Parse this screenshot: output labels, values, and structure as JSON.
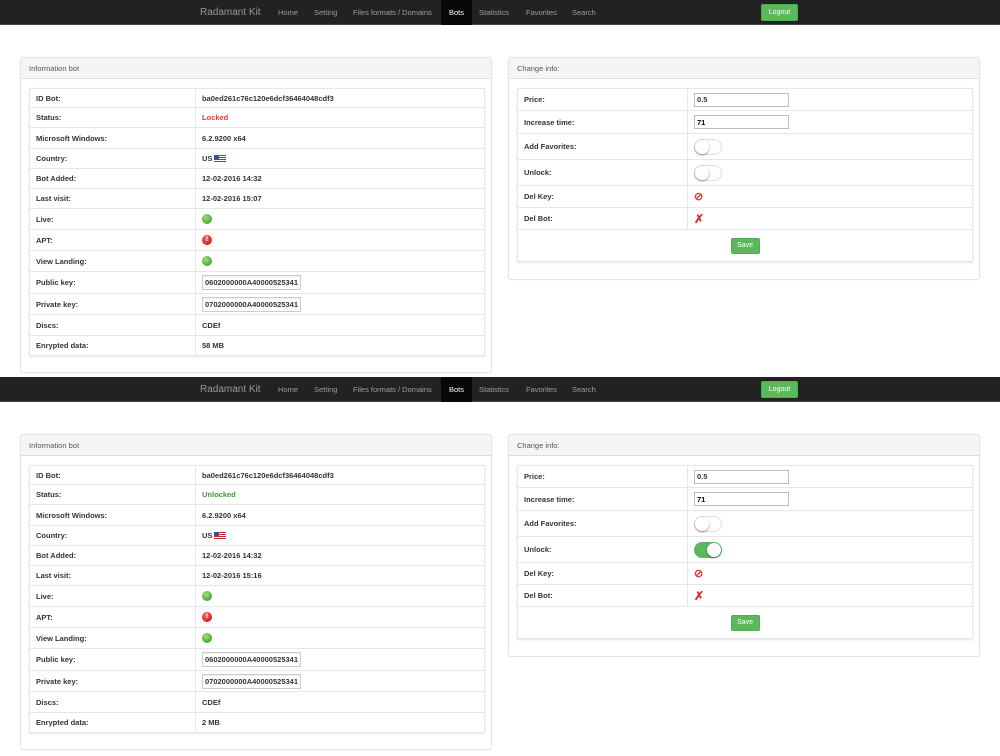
{
  "screens": [
    {
      "nav": {
        "brand": "Radamant Kit",
        "items": [
          "Home",
          "Setting",
          "Files formats / Domains",
          "Bots",
          "Statistics",
          "Favorites",
          "Search"
        ],
        "active": "Bots",
        "logout": "Logout"
      },
      "info": {
        "title": "Information bot",
        "rows": [
          {
            "label": "ID Bot:",
            "value": "ba0ed261c76c120e6dcf36464048cdf3"
          },
          {
            "label": "Status:",
            "value": "Locked",
            "type": "status-locked"
          },
          {
            "label": "Microsoft Windows:",
            "value": "6.2.9200 x64"
          },
          {
            "label": "Country:",
            "value": "US",
            "type": "flag"
          },
          {
            "label": "Bot Added:",
            "value": "12-02-2016 14:32"
          },
          {
            "label": "Last visit:",
            "value": "12-02-2016 15:07"
          },
          {
            "label": "Live:",
            "icon": "check-circle-icon",
            "type": "ok"
          },
          {
            "label": "APT:",
            "icon": "alert-circle-icon",
            "type": "err"
          },
          {
            "label": "View Landing:",
            "icon": "check-circle-icon",
            "type": "ok"
          },
          {
            "label": "Public key:",
            "value": "0602000000A40000525341",
            "type": "key"
          },
          {
            "label": "Private key:",
            "value": "0702000000A40000525341",
            "type": "key"
          },
          {
            "label": "Discs:",
            "value": "CDEf"
          },
          {
            "label": "Enrypted data:",
            "value": "58 MB"
          }
        ]
      },
      "change": {
        "title": "Change info:",
        "price_label": "Price:",
        "price": "0.5",
        "increase_label": "Increase time:",
        "increase": "71",
        "favorites_label": "Add Favorites:",
        "favorites_on": false,
        "unlock_label": "Unlock:",
        "unlock_on": false,
        "delkey_label": "Del Key:",
        "delbot_label": "Del Bot:",
        "save": "Save"
      }
    },
    {
      "nav": {
        "brand": "Radamant Kit",
        "items": [
          "Home",
          "Setting",
          "Files formats / Domains",
          "Bots",
          "Statistics",
          "Favorites",
          "Search"
        ],
        "active": "Bots",
        "logout": "Logout"
      },
      "info": {
        "title": "Information bot",
        "rows": [
          {
            "label": "ID Bot:",
            "value": "ba0ed261c76c120e6dcf36464048cdf3"
          },
          {
            "label": "Status:",
            "value": "Unlocked",
            "type": "status-unlocked"
          },
          {
            "label": "Microsoft Windows:",
            "value": "6.2.9200 x64"
          },
          {
            "label": "Country:",
            "value": "US",
            "type": "flag"
          },
          {
            "label": "Bot Added:",
            "value": "12-02-2016 14:32"
          },
          {
            "label": "Last visit:",
            "value": "12-02-2016 15:16"
          },
          {
            "label": "Live:",
            "icon": "check-circle-icon",
            "type": "ok"
          },
          {
            "label": "APT:",
            "icon": "alert-circle-icon",
            "type": "err"
          },
          {
            "label": "View Landing:",
            "icon": "check-circle-icon",
            "type": "ok"
          },
          {
            "label": "Public key:",
            "value": "0602000000A40000525341",
            "type": "key"
          },
          {
            "label": "Private key:",
            "value": "0702000000A40000525341",
            "type": "key"
          },
          {
            "label": "Discs:",
            "value": "CDEf"
          },
          {
            "label": "Enrypted data:",
            "value": "2 MB"
          }
        ]
      },
      "change": {
        "title": "Change info:",
        "price_label": "Price:",
        "price": "0.5",
        "increase_label": "Increase time:",
        "increase": "71",
        "favorites_label": "Add Favorites:",
        "favorites_on": false,
        "unlock_label": "Unlock:",
        "unlock_on": true,
        "delkey_label": "Del Key:",
        "delbot_label": "Del Bot:",
        "save": "Save"
      }
    }
  ],
  "colors": {
    "navbar": "#222222",
    "success": "#5cb85c",
    "locked": "#e53935",
    "unlocked": "#3c9a3c"
  }
}
